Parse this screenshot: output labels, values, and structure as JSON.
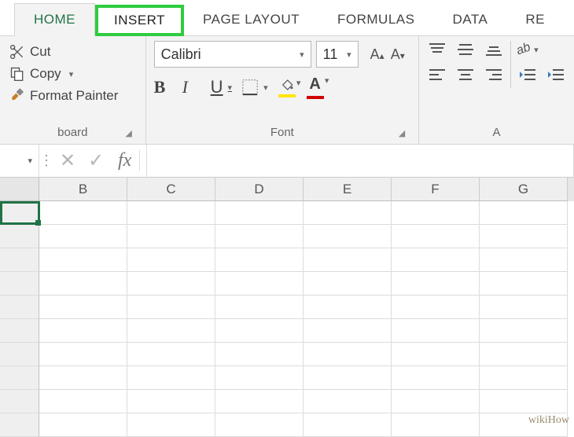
{
  "tabs": {
    "home": "HOME",
    "insert": "INSERT",
    "page_layout": "PAGE LAYOUT",
    "formulas": "FORMULAS",
    "data": "DATA",
    "review_partial": "RE"
  },
  "clipboard": {
    "cut": "Cut",
    "copy": "Copy",
    "format_painter": "Format Painter",
    "group_label": "board"
  },
  "font": {
    "family": "Calibri",
    "size": "11",
    "group_label": "Font",
    "buttons": {
      "bold": "B",
      "italic": "I",
      "underline": "U"
    }
  },
  "alignment": {
    "group_label_partial": "A"
  },
  "formula_bar": {
    "fx": "fx",
    "value": ""
  },
  "columns": [
    "B",
    "C",
    "D",
    "E",
    "F",
    "G"
  ],
  "row_count": 10,
  "colors": {
    "fill_swatch": "#ffe600",
    "font_swatch": "#d30000",
    "excel_green": "#217346"
  },
  "watermark": "wikiHow"
}
